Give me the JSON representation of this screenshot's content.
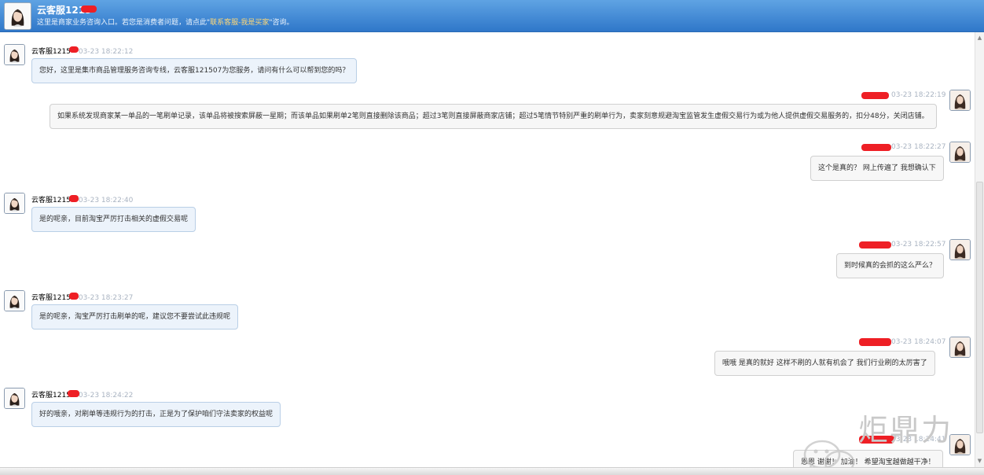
{
  "header": {
    "title": "云客服1215",
    "notice_prefix": "这里是商家业务咨询入口。若您是消费者问题，请点此\"",
    "notice_link": "联系客服-我是买家",
    "notice_suffix": "\"咨询。"
  },
  "messages": [
    {
      "side": "left",
      "name": "云客服1215",
      "time": "03-23 18:22:12",
      "text": "您好，这里是集市商品管理服务咨询专线，云客服121507为您服务，请问有什么可以帮到您的吗？"
    },
    {
      "side": "right",
      "name": "",
      "time": "03-23 18:22:19",
      "text": "如果系统发现商家某一单品的一笔刷单记录，该单品将被搜索屏蔽一星期；而该单品如果刷单2笔则直接删除该商品；超过3笔则直接屏蔽商家店铺；超过5笔情节特别严重的刷单行为，卖家刻意规避淘宝监管发生虚假交易行为或为他人提供虚假交易服务的，扣分48分，关闭店铺。"
    },
    {
      "side": "right",
      "name": "",
      "time": "03-23 18:22:27",
      "text": "这个是真的？ 网上传遍了 我想确认下"
    },
    {
      "side": "left",
      "name": "云客服1215",
      "time": "03-23 18:22:40",
      "text": "是的呢亲，目前淘宝严厉打击相关的虚假交易呢"
    },
    {
      "side": "right",
      "name": "",
      "time": "03-23 18:22:57",
      "text": "到时候真的会抓的这么严么？"
    },
    {
      "side": "left",
      "name": "云客服1215",
      "time": "03-23 18:23:27",
      "text": "是的呢亲，淘宝严厉打击刷单的呢，建议您不要尝试此违规呢"
    },
    {
      "side": "right",
      "name": "",
      "time": "03-23 18:24:07",
      "text": "哦哦  是真的就好  这样不刷的人就有机会了  我们行业刷的太厉害了"
    },
    {
      "side": "left",
      "name": "云客服1215",
      "time": "03-23 18:24:22",
      "text": "好的哦亲，对刷单等违规行为的打击，正是为了保护咱们守法卖家的权益呢"
    },
    {
      "side": "right",
      "name": "",
      "time": "03-23 18:24:41",
      "text": "恩恩 谢谢！ 加油！ 希望淘宝越做越干净！"
    }
  ],
  "watermark": {
    "text": "炬鼎力",
    "icon": "wechat-icon"
  },
  "colors": {
    "header_top": "#5fa3e3",
    "header_bottom": "#2f77c9",
    "link": "#ffd877",
    "scribble": "#ee1f25",
    "time": "#aab4c2"
  }
}
